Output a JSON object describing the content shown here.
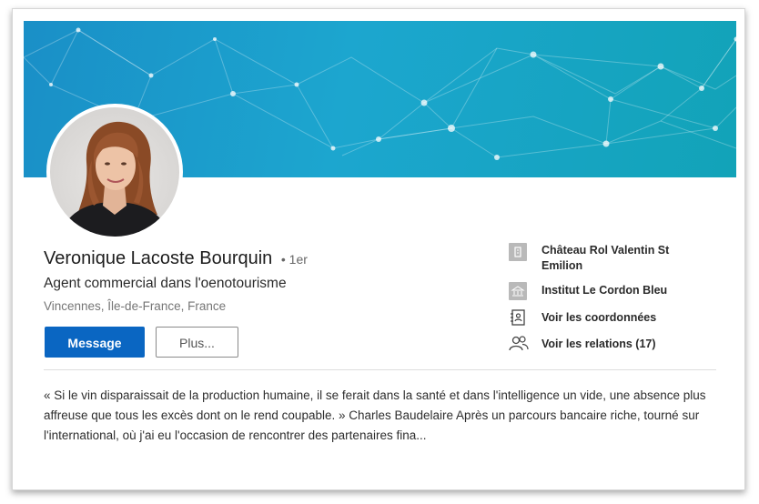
{
  "profile": {
    "name": "Veronique Lacoste Bourquin",
    "degree": "• 1er",
    "headline": "Agent commercial dans l'oenotourisme",
    "location": "Vincennes, Île-de-France, France"
  },
  "actions": {
    "message_label": "Message",
    "more_label": "Plus..."
  },
  "sidebar": {
    "items": [
      {
        "label": "Château Rol Valentin St Emilion",
        "icon": "company-logo-icon"
      },
      {
        "label": "Institut Le Cordon Bleu",
        "icon": "school-logo-icon"
      },
      {
        "label": "Voir les coordonnées",
        "icon": "contact-card-icon"
      },
      {
        "label": "Voir les relations (17)",
        "icon": "people-icon"
      }
    ]
  },
  "about": {
    "text": "« Si le vin disparaissait de la production humaine, il se ferait dans la santé et dans l'intelligence un vide, une absence plus affreuse que tous les excès dont on le rend coupable. » Charles Baudelaire Après un parcours bancaire riche, tourné sur l'international, où j'ai eu l'occasion de rencontrer des partenaires fina..."
  },
  "colors": {
    "primary_button": "#0a66c2",
    "banner": "#1ca6cf"
  }
}
